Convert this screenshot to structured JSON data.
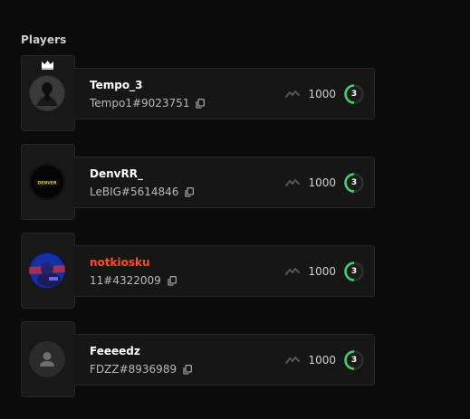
{
  "section": {
    "title": "Players"
  },
  "players": [
    {
      "name": "Tempo_3",
      "tag": "Tempo1#9023751",
      "rating": "1000",
      "level": "3",
      "leader": true,
      "name_color": "#ffffff",
      "avatar": "dark-figure"
    },
    {
      "name": "DenvRR_",
      "tag": "LeBIG#5614846",
      "rating": "1000",
      "level": "3",
      "leader": false,
      "name_color": "#ffffff",
      "avatar": "denver-logo",
      "avatar_text": "DENVER"
    },
    {
      "name": "notkiosku",
      "tag": "11#4322009",
      "rating": "1000",
      "level": "3",
      "leader": false,
      "name_color": "#ff4a1c",
      "avatar": "blue-character"
    },
    {
      "name": "Feeeedz",
      "tag": "FDZZ#8936989",
      "rating": "1000",
      "level": "3",
      "leader": false,
      "name_color": "#ffffff",
      "avatar": "default-user"
    }
  ],
  "colors": {
    "accent": "#ff4a1c",
    "level_ring": "#3fd36a",
    "background": "#0b0b0b",
    "card": "#161616"
  },
  "icons": {
    "crown": "crown-icon",
    "copy": "copy-icon",
    "trend": "trend-icon",
    "default_avatar": "user-silhouette-icon"
  }
}
